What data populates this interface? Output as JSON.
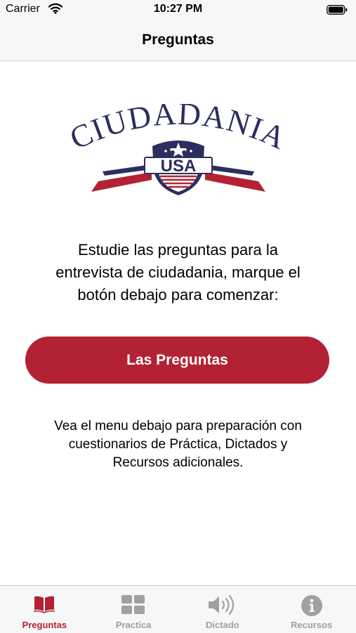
{
  "status_bar": {
    "carrier": "Carrier",
    "time": "10:27 PM"
  },
  "nav": {
    "title": "Preguntas"
  },
  "logo": {
    "text": "CIUDADANIA",
    "badge": "USA"
  },
  "main": {
    "intro": "Estudie las preguntas para la\nentrevista de ciudadania, marque el\nbotón debajo para comenzar:",
    "button_label": "Las Preguntas",
    "footnote": "Vea el menu debajo para preparación con\ncuestionarios de Práctica, Dictados y\nRecursos adicionales."
  },
  "tabs": [
    {
      "label": "Preguntas",
      "icon": "book-icon",
      "selected": true
    },
    {
      "label": "Practica",
      "icon": "grid-icon",
      "selected": false
    },
    {
      "label": "Dictado",
      "icon": "speaker-icon",
      "selected": false
    },
    {
      "label": "Recursos",
      "icon": "info-icon",
      "selected": false
    }
  ],
  "colors": {
    "accent": "#b22234",
    "navy": "#2c2e5e",
    "inactive": "#a0a0a0",
    "bar_bg": "#f7f7f7"
  }
}
